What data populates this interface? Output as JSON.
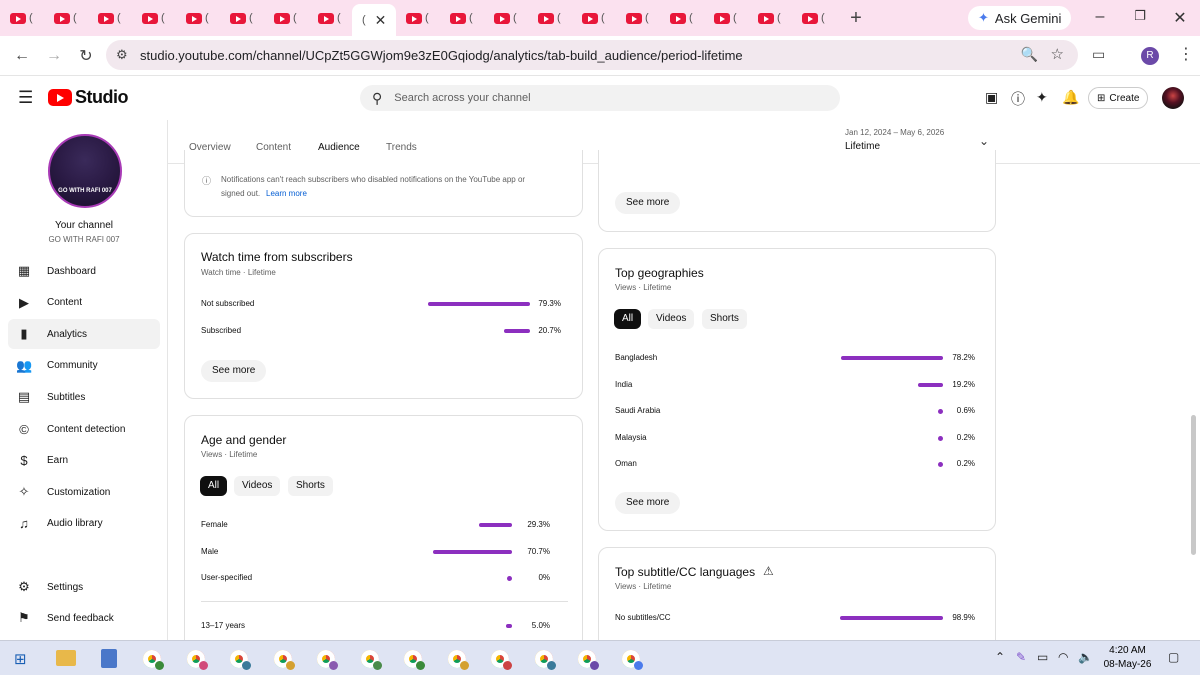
{
  "browser": {
    "tab_count_youtube": 10,
    "tab_count_after": 11,
    "new_tab_label": "+",
    "gemini_label": "Ask Gemini",
    "url": "studio.youtube.com/channel/UCpZt5GGWjom9e3zE0Gqiodg/analytics/tab-build_audience/period-lifetime",
    "profile_initial": "R"
  },
  "header": {
    "logo_text": "Studio",
    "search_placeholder": "Search across your channel",
    "create_label": "Create"
  },
  "sidebar": {
    "avatar_text": "GO WITH RAFI 007",
    "your_channel": "Your channel",
    "channel_name": "GO WITH RAFI 007",
    "items": [
      {
        "label": "Dashboard",
        "icon": "dashboard-icon",
        "glyph": "▦"
      },
      {
        "label": "Content",
        "icon": "content-icon",
        "glyph": "▶"
      },
      {
        "label": "Analytics",
        "icon": "analytics-icon",
        "glyph": "▮"
      },
      {
        "label": "Community",
        "icon": "community-icon",
        "glyph": "👥"
      },
      {
        "label": "Subtitles",
        "icon": "subtitles-icon",
        "glyph": "▤"
      },
      {
        "label": "Content detection",
        "icon": "copyright-icon",
        "glyph": "©"
      },
      {
        "label": "Earn",
        "icon": "earn-icon",
        "glyph": "$"
      },
      {
        "label": "Customization",
        "icon": "customization-icon",
        "glyph": "✧"
      },
      {
        "label": "Audio library",
        "icon": "audio-library-icon",
        "glyph": "♫"
      }
    ],
    "settings": "Settings",
    "feedback": "Send feedback"
  },
  "analytics_tabs": [
    "Overview",
    "Content",
    "Audience",
    "Trends"
  ],
  "period": {
    "range": "Jan 12, 2024 – May 6, 2026",
    "label": "Lifetime"
  },
  "notif_card": {
    "text_line1": "Notifications can't reach subscribers who disabled notifications on the YouTube app or",
    "text_line2": "signed out.",
    "link": "Learn more"
  },
  "watch_time": {
    "title": "Watch time from subscribers",
    "subtitle": "Watch time · Lifetime",
    "rows": [
      {
        "label": "Not subscribed",
        "value": "79.3%",
        "pct": 79.3
      },
      {
        "label": "Subscribed",
        "value": "20.7%",
        "pct": 20.7
      }
    ],
    "see_more": "See more"
  },
  "age_gender": {
    "title": "Age and gender",
    "subtitle": "Views · Lifetime",
    "chips": [
      "All",
      "Videos",
      "Shorts"
    ],
    "rows": [
      {
        "label": "Female",
        "value": "29.3%",
        "pct": 29.3
      },
      {
        "label": "Male",
        "value": "70.7%",
        "pct": 70.7
      },
      {
        "label": "User-specified",
        "value": "0%",
        "pct": 0
      }
    ],
    "age_rows": [
      {
        "label": "13–17 years",
        "value": "5.0%",
        "pct": 5.0
      }
    ]
  },
  "top_see_more": "See more",
  "geographies": {
    "title": "Top geographies",
    "subtitle": "Views · Lifetime",
    "chips": [
      "All",
      "Videos",
      "Shorts"
    ],
    "rows": [
      {
        "label": "Bangladesh",
        "value": "78.2%",
        "pct": 78.2
      },
      {
        "label": "India",
        "value": "19.2%",
        "pct": 19.2
      },
      {
        "label": "Saudi Arabia",
        "value": "0.6%",
        "pct": 0.6
      },
      {
        "label": "Malaysia",
        "value": "0.2%",
        "pct": 0.2
      },
      {
        "label": "Oman",
        "value": "0.2%",
        "pct": 0.2
      }
    ],
    "see_more": "See more"
  },
  "subtitles_card": {
    "title": "Top subtitle/CC languages",
    "subtitle": "Views · Lifetime",
    "rows": [
      {
        "label": "No subtitles/CC",
        "value": "98.9%",
        "pct": 98.9
      }
    ]
  },
  "taskbar": {
    "time": "4:20 AM",
    "date": "08-May-26"
  },
  "colors": {
    "accent": "#8c2fbf",
    "tabbar": "#fbe1ef",
    "youtube_red": "#ff0000"
  }
}
